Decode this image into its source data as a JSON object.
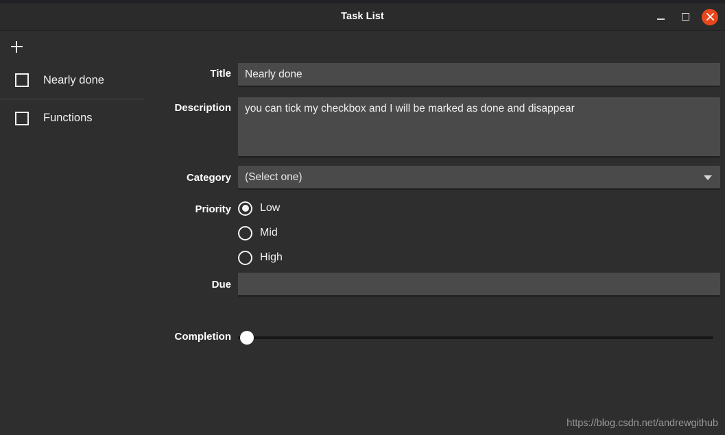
{
  "window": {
    "title": "Task List",
    "controls": {
      "minimize_label": "Minimize",
      "maximize_label": "Maximize",
      "close_label": "Close"
    },
    "colors": {
      "window_bg": "#2e2e2e",
      "titlebar_bg": "#2b2b2b",
      "input_bg": "#4a4a4a",
      "close_button": "#e8471d",
      "text": "#f0f0f0",
      "slider_track": "#171717",
      "slider_handle": "#ffffff"
    }
  },
  "sidebar": {
    "add_button_label": "+",
    "items": [
      {
        "label": "Nearly done",
        "checked": false
      },
      {
        "label": "Functions",
        "checked": false
      }
    ]
  },
  "form": {
    "title": {
      "label": "Title",
      "value": "Nearly done",
      "placeholder": ""
    },
    "description": {
      "label": "Description",
      "value": "you can tick my checkbox and I will be marked as done and disappear",
      "placeholder": ""
    },
    "category": {
      "label": "Category",
      "value": "(Select one)",
      "options": [
        "(Select one)"
      ]
    },
    "priority": {
      "label": "Priority",
      "selected": "Low",
      "options": [
        {
          "label": "Low",
          "selected": true
        },
        {
          "label": "Mid",
          "selected": false
        },
        {
          "label": "High",
          "selected": false
        }
      ]
    },
    "due": {
      "label": "Due",
      "value": "",
      "placeholder": ""
    },
    "completion": {
      "label": "Completion",
      "value": 0,
      "min": 0,
      "max": 100
    }
  },
  "watermark": {
    "text": "https://blog.csdn.net/andrewgithub"
  }
}
